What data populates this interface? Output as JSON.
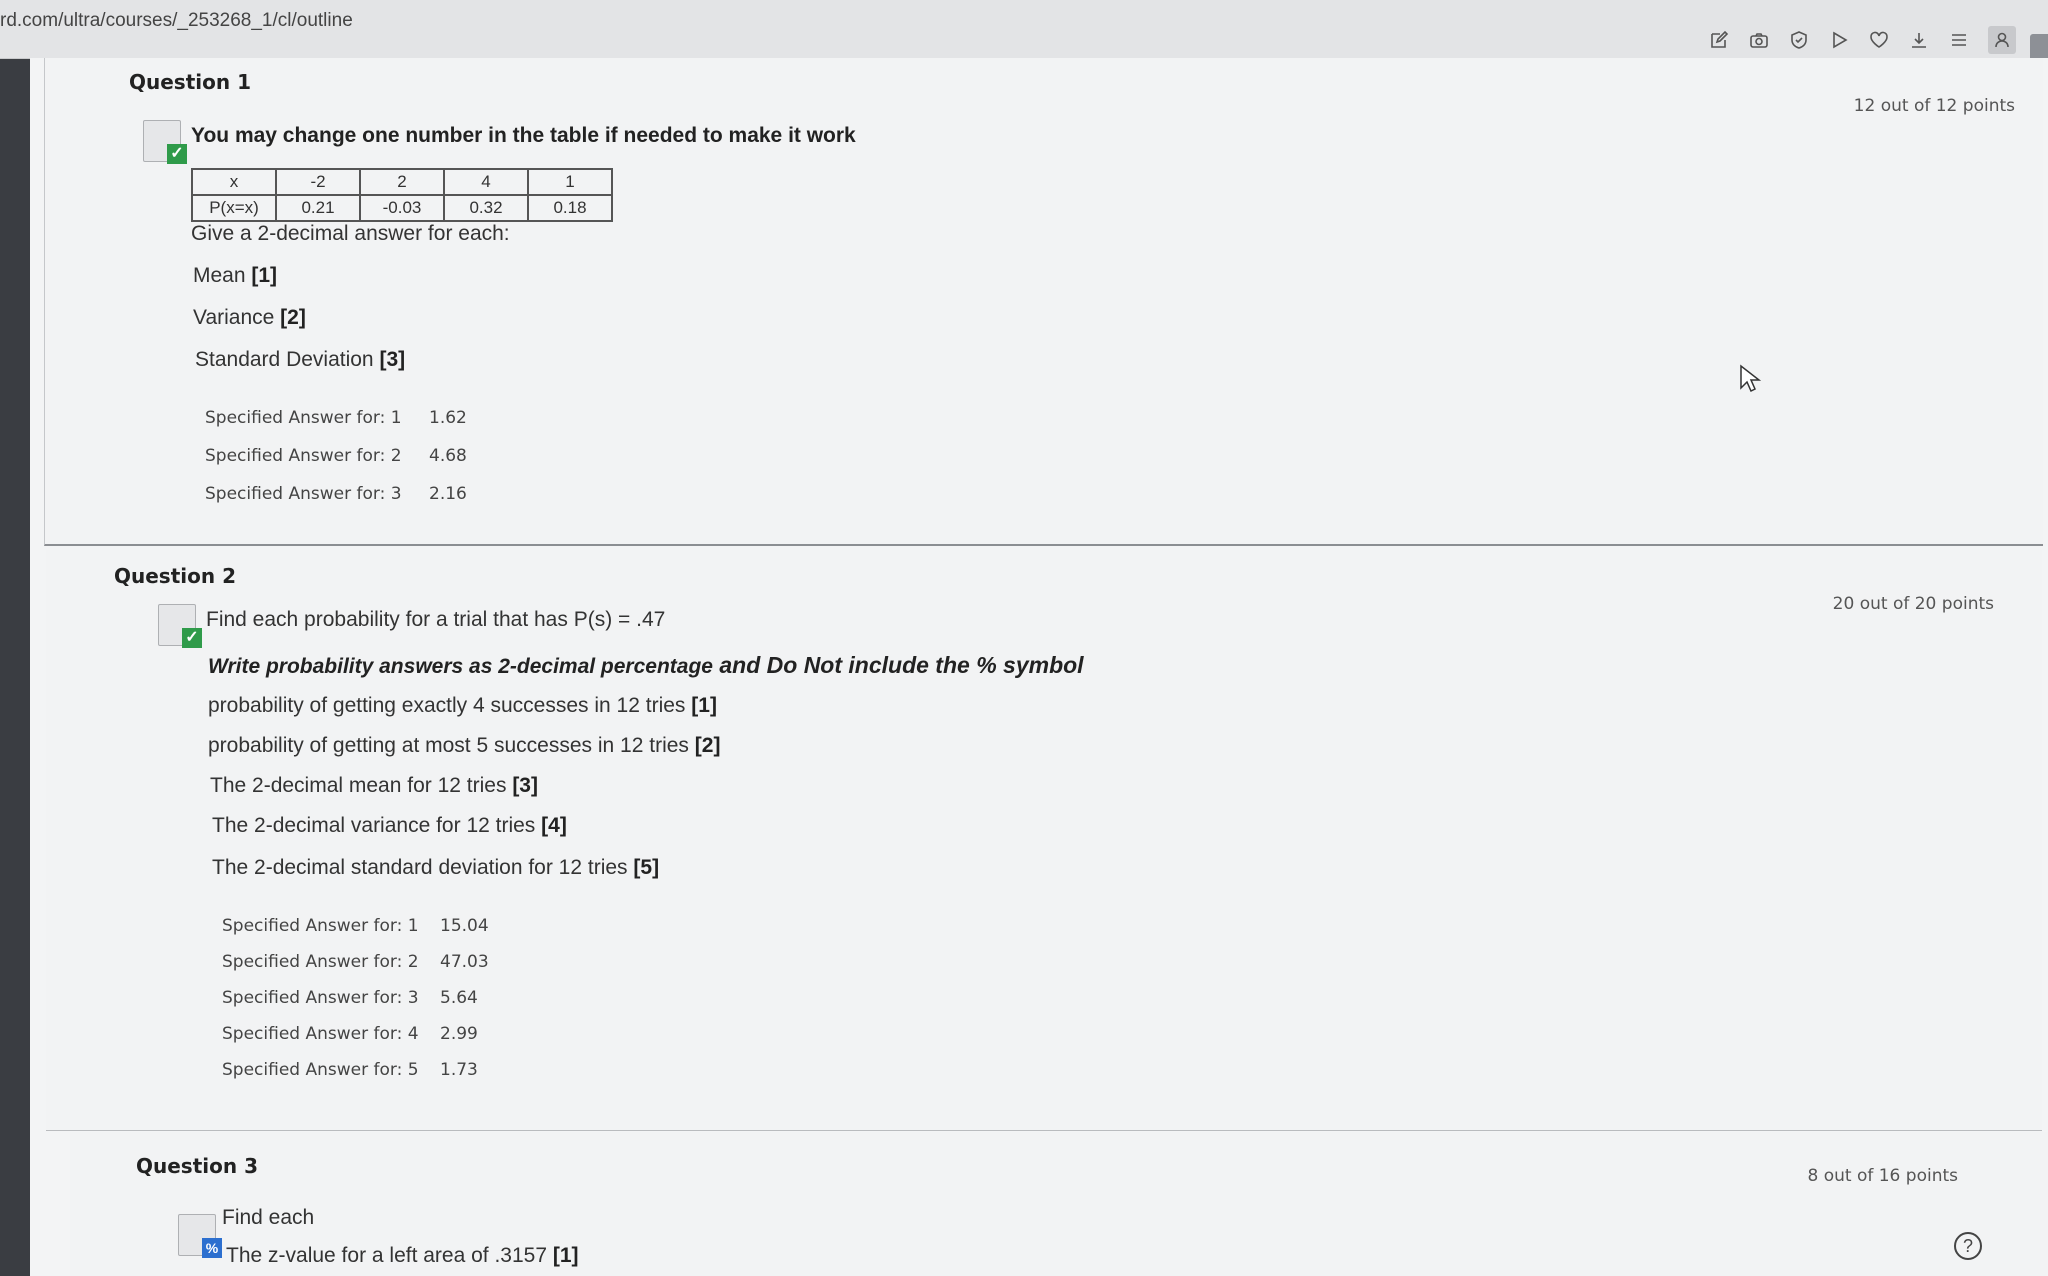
{
  "browser": {
    "url": "rd.com/ultra/courses/_253268_1/cl/outline",
    "toolbar_icons": [
      "edit-icon",
      "camera-icon",
      "shield-icon",
      "play-icon",
      "heart-icon",
      "download-icon",
      "menu-icon",
      "profile-icon"
    ]
  },
  "questions": [
    {
      "title": "Question 1",
      "points": "12 out of 12 points",
      "status": "correct",
      "prompt": "You may change one number in the table if needed to make it work",
      "table": {
        "header": [
          "x",
          "-2",
          "2",
          "4",
          "1"
        ],
        "row": [
          "P(x=x)",
          "0.21",
          "-0.03",
          "0.32",
          "0.18"
        ]
      },
      "instruction": "Give a 2-decimal answer for each:",
      "parts": [
        {
          "text": "Mean",
          "tag": "[1]"
        },
        {
          "text": "Variance",
          "tag": "[2]"
        },
        {
          "text": "Standard Deviation",
          "tag": "[3]"
        }
      ],
      "answers": [
        {
          "label": "Specified Answer for: 1",
          "value": "1.62"
        },
        {
          "label": "Specified Answer for: 2",
          "value": "4.68"
        },
        {
          "label": "Specified Answer for: 3",
          "value": "2.16"
        }
      ]
    },
    {
      "title": "Question 2",
      "points": "20 out of 20 points",
      "status": "correct",
      "prompt": "Find each probability for a trial that has P(s) = .47",
      "instruction_italic": "Write probability answers as 2-decimal percentage",
      "instruction_rest": " and Do Not include the % symbol",
      "parts": [
        {
          "text": "probability of getting exactly 4 successes in 12 tries",
          "tag": "[1]"
        },
        {
          "text": "probability of getting at most 5 successes in 12 tries",
          "tag": "[2]"
        },
        {
          "text": "The 2-decimal mean for 12 tries",
          "tag": "[3]"
        },
        {
          "text": "The 2-decimal  variance for 12 tries",
          "tag": "[4]"
        },
        {
          "text": "The 2-decimal standard deviation for 12 tries",
          "tag": "[5]"
        }
      ],
      "answers": [
        {
          "label": "Specified Answer for: 1",
          "value": "15.04"
        },
        {
          "label": "Specified Answer for: 2",
          "value": "47.03"
        },
        {
          "label": "Specified Answer for: 3",
          "value": "5.64"
        },
        {
          "label": "Specified Answer for: 4",
          "value": "2.99"
        },
        {
          "label": "Specified Answer for: 5",
          "value": "1.73"
        }
      ]
    },
    {
      "title": "Question 3",
      "points": "8 out of 16 points",
      "status": "partial",
      "prompt": "Find each",
      "parts": [
        {
          "text": "The z-value for a left area of .3157",
          "tag": "[1]"
        }
      ]
    }
  ],
  "colors": {
    "correct_badge": "#2f9b4a",
    "partial_badge": "#2c6fcf"
  }
}
